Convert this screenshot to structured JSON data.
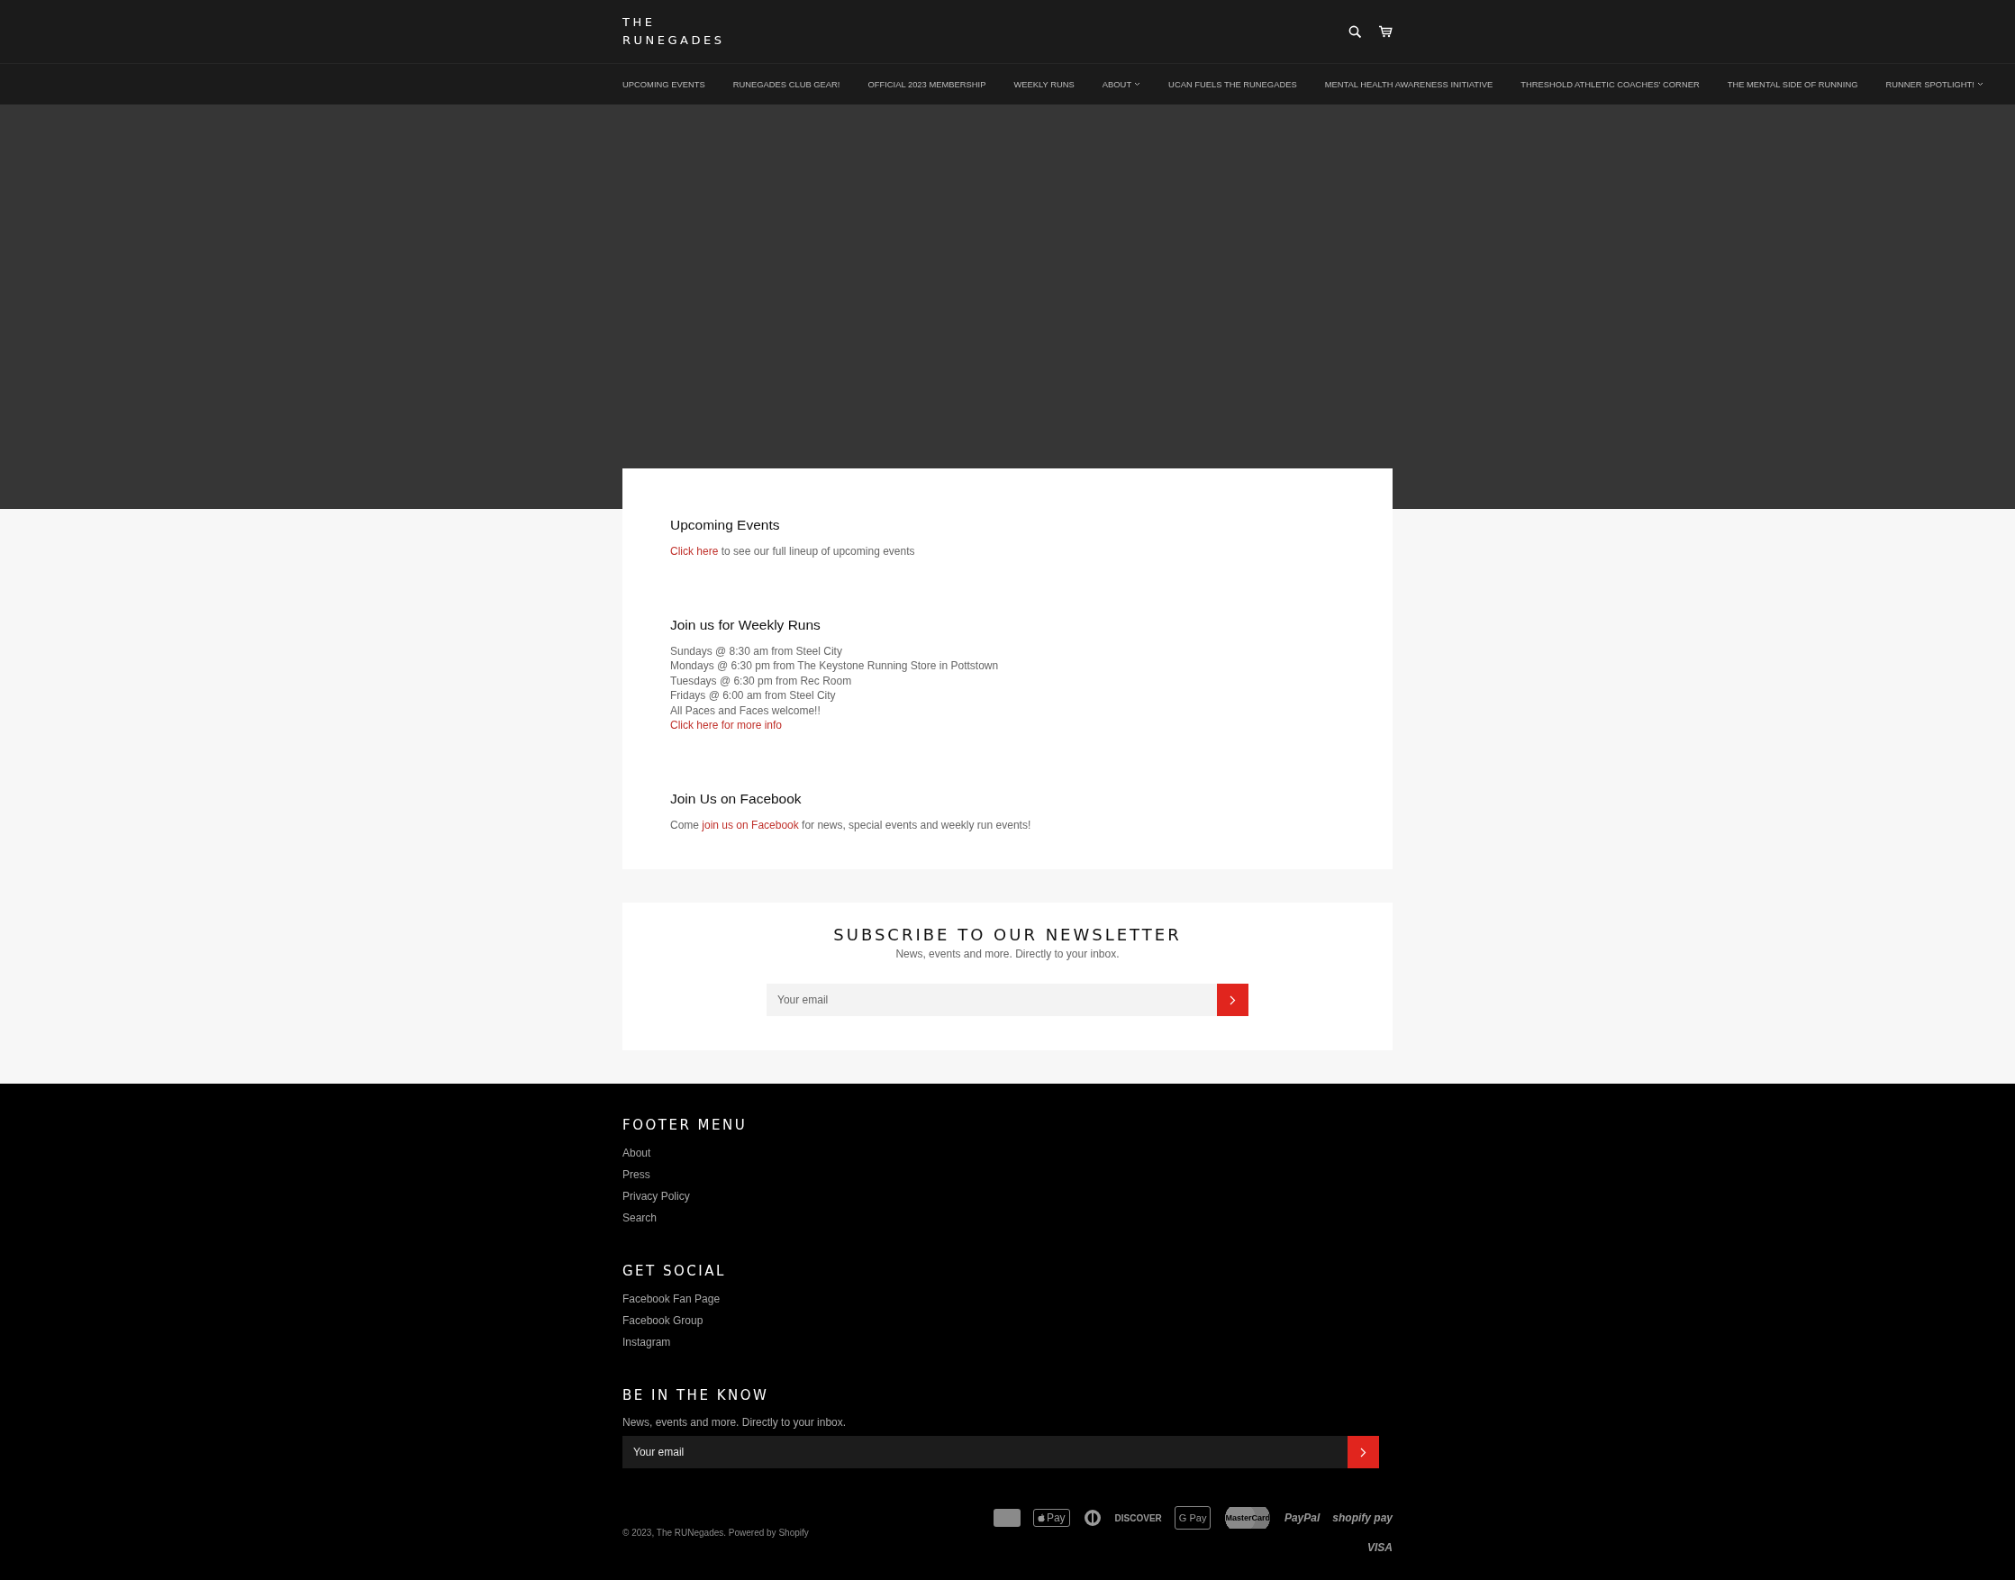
{
  "header": {
    "logo_lines": [
      "THE",
      "RUNEGADES"
    ]
  },
  "nav": [
    {
      "label": "UPCOMING EVENTS",
      "has_dropdown": false
    },
    {
      "label": "RUNEGADES CLUB GEAR!",
      "has_dropdown": false
    },
    {
      "label": "OFFICIAL 2023 MEMBERSHIP",
      "has_dropdown": false
    },
    {
      "label": "WEEKLY RUNS",
      "has_dropdown": false
    },
    {
      "label": "ABOUT",
      "has_dropdown": true
    },
    {
      "label": "UCAN FUELS THE RUNEGADES",
      "has_dropdown": false
    },
    {
      "label": "MENTAL HEALTH AWARENESS INITIATIVE",
      "has_dropdown": false
    },
    {
      "label": "THRESHOLD ATHLETIC COACHES' CORNER",
      "has_dropdown": false
    },
    {
      "label": "THE MENTAL SIDE OF RUNNING",
      "has_dropdown": false
    },
    {
      "label": "RUNNER SPOTLIGHT!",
      "has_dropdown": true
    }
  ],
  "content_blocks": [
    {
      "title": "Upcoming Events",
      "lines": [
        {
          "link": "Click here",
          "after": " to see our full lineup of upcoming events"
        }
      ]
    },
    {
      "title": "Join us for Weekly Runs",
      "lines": [
        {
          "before": "Sundays @ 8:30 am from Steel City"
        },
        {
          "before": "Mondays @ 6:30 pm from The Keystone Running Store in Pottstown"
        },
        {
          "before": "Tuesdays @ 6:30 pm from Rec Room"
        },
        {
          "before": "Fridays @ 6:00 am from Steel City"
        },
        {
          "before": "All Paces and Faces welcome!!"
        },
        {
          "link": "Click here for more info"
        }
      ]
    },
    {
      "title": "Join Us on Facebook",
      "lines": [
        {
          "before": "Come ",
          "link": "join us on Facebook",
          "after": " for news, special events and weekly run events!"
        }
      ]
    }
  ],
  "newsletter": {
    "title": "SUBSCRIBE TO OUR NEWSLETTER",
    "subtitle": "News, events and more. Directly to your inbox.",
    "placeholder": "Your email"
  },
  "footer": {
    "sections": [
      {
        "title": "FOOTER MENU",
        "links": [
          "About",
          "Press",
          "Privacy Policy",
          "Search"
        ]
      },
      {
        "title": "GET SOCIAL",
        "links": [
          "Facebook Fan Page",
          "Facebook Group",
          "Instagram"
        ]
      }
    ],
    "signup": {
      "title": "BE IN THE KNOW",
      "text": "News, events and more. Directly to your inbox.",
      "placeholder": "Your email"
    },
    "copyright": "© 2023, The RUNegades. Powered by Shopify",
    "payments": [
      {
        "kind": "amex"
      },
      {
        "kind": "applepay",
        "label": "Pay"
      },
      {
        "kind": "diners"
      },
      {
        "kind": "discover",
        "label": "DISCOVER"
      },
      {
        "kind": "gpay",
        "label": "G Pay"
      },
      {
        "kind": "mastercard",
        "label": "MasterCard"
      },
      {
        "kind": "paypal",
        "label": "PayPal"
      },
      {
        "kind": "shopifypay",
        "label": "shopify pay"
      },
      {
        "kind": "visa",
        "label": "VISA"
      }
    ]
  }
}
